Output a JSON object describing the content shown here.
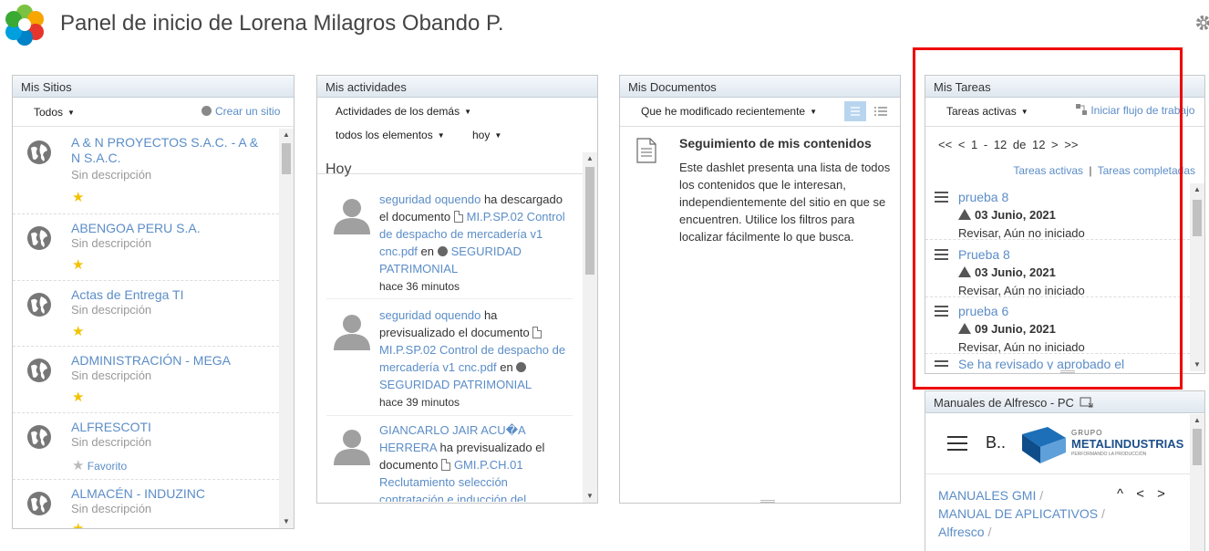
{
  "header": {
    "title": "Panel de inicio de Lorena Milagros Obando P."
  },
  "sitios": {
    "title": "Mis Sitios",
    "filter": "Todos",
    "create_link": "Crear un sitio",
    "items": [
      {
        "name": "A & N PROYECTOS S.A.C. - A & N S.A.C.",
        "description": "Sin descripción",
        "favorite": true
      },
      {
        "name": "ABENGOA PERU S.A.",
        "description": "Sin descripción",
        "favorite": true
      },
      {
        "name": "Actas de Entrega TI",
        "description": "Sin descripción",
        "favorite": true
      },
      {
        "name": "ADMINISTRACIÓN - MEGA",
        "description": "Sin descripción",
        "favorite": true
      },
      {
        "name": "ALFRESCOTI",
        "description": "Sin descripción",
        "favorite": false,
        "favorite_label": "Favorito"
      },
      {
        "name": "ALMACÉN - INDUZINC",
        "description": "Sin descripción",
        "favorite": true
      }
    ]
  },
  "actividades": {
    "title": "Mis actividades",
    "filter_user": "Actividades de los demás",
    "filter_items": "todos los elementos",
    "filter_time": "hoy",
    "day_label": "Hoy",
    "items": [
      {
        "user": "seguridad oquendo",
        "action": " ha descargado el documento ",
        "document": "MI.P.SP.02 Control de despacho de mercadería v1 cnc.pdf",
        "preposition": " en ",
        "site": "SEGURIDAD PATRIMONIAL",
        "time": "hace 36 minutos"
      },
      {
        "user": "seguridad oquendo",
        "action": " ha previsualizado el documento ",
        "document": "MI.P.SP.02 Control de despacho de mercadería v1 cnc.pdf",
        "preposition": " en ",
        "site": "SEGURIDAD PATRIMONIAL",
        "time": "hace 39 minutos"
      },
      {
        "user": "GIANCARLO JAIR ACU�A HERRERA",
        "action": " ha previsualizado el documento ",
        "document": "GMI.P.CH.01 Reclutamiento selección contratación e inducción del",
        "preposition": "",
        "site": "",
        "time": ""
      }
    ]
  },
  "documentos": {
    "title": "Mis Documentos",
    "filter": "Que he modificado recientemente",
    "heading": "Seguimiento de mis contenidos",
    "body": "Este dashlet presenta una lista de todos los contenidos que le interesan, independientemente del sitio en que se encuentren. Utilice los filtros para localizar fácilmente lo que busca."
  },
  "tareas": {
    "title": "Mis Tareas",
    "filter": "Tareas activas",
    "start_workflow": "Iniciar flujo de trabajo",
    "pager": {
      "first": "<<",
      "prev": "<",
      "range": "1 - 12 de 12",
      "next": ">",
      "last": ">>"
    },
    "filter_active": "Tareas activas",
    "filter_separator": "|",
    "filter_completed": "Tareas completadas",
    "items": [
      {
        "name": "prueba 8",
        "date": "03 Junio, 2021",
        "status": "Revisar, Aún no iniciado"
      },
      {
        "name": "Prueba 8",
        "date": "03 Junio, 2021",
        "status": "Revisar, Aún no iniciado"
      },
      {
        "name": "prueba 6",
        "date": "09 Junio, 2021",
        "status": "Revisar, Aún no iniciado"
      },
      {
        "name": "Se ha revisado y aprobado el",
        "date": "",
        "status": ""
      }
    ]
  },
  "manuales": {
    "title": "Manuales de Alfresco - PC",
    "band_letter": "B..",
    "logo_top": "GRUPO",
    "logo_main": "METALINDUSTRIAS",
    "logo_tagline": "PERFORMANDO LA PRODUCCIÓN",
    "crumbs": [
      "MANUALES GMI",
      "MANUAL DE APLICATIVOS",
      "Alfresco"
    ],
    "crumb_separator": "/",
    "nav": [
      "^",
      "<",
      ">"
    ]
  },
  "colors": {
    "link": "#5b8dc7",
    "star": "#f2c200",
    "highlight": "#e00000"
  }
}
